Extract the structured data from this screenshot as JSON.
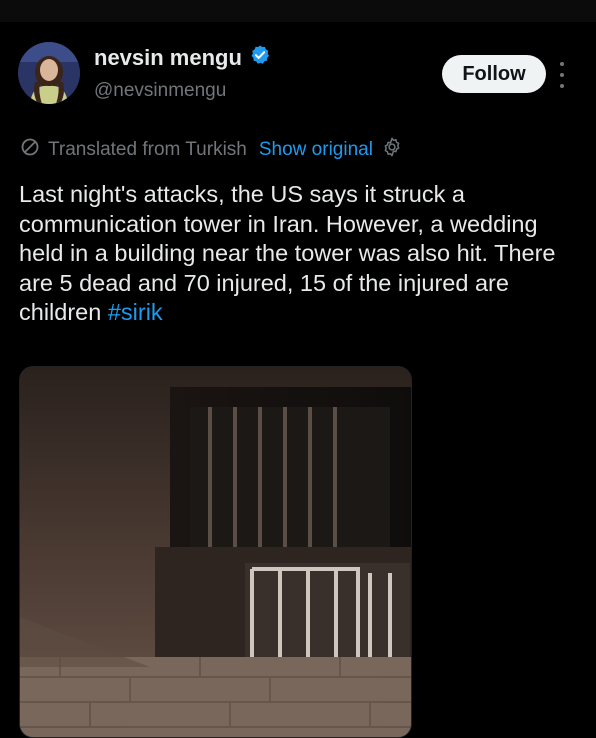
{
  "author": {
    "display_name": "nevsin mengu",
    "handle": "@nevsinmengu",
    "verified": true
  },
  "follow_label": "Follow",
  "translation": {
    "label": "Translated from Turkish",
    "show_original": "Show original"
  },
  "tweet": {
    "text": "Last night's attacks, the US says it struck a communication tower in Iran. However, a wedding held in a building near the tower was also hit. There are 5 dead and 70 injured, 15 of the injured are children ",
    "hashtag": "#sirik"
  },
  "colors": {
    "background": "#000000",
    "text": "#e7e9ea",
    "muted": "#71767b",
    "link": "#1d9bf0",
    "verified": "#1d9bf0",
    "follow_bg": "#eff3f4"
  },
  "icons": [
    "verified-badge-icon",
    "more-options-icon",
    "translate-icon",
    "settings-gear-icon"
  ]
}
